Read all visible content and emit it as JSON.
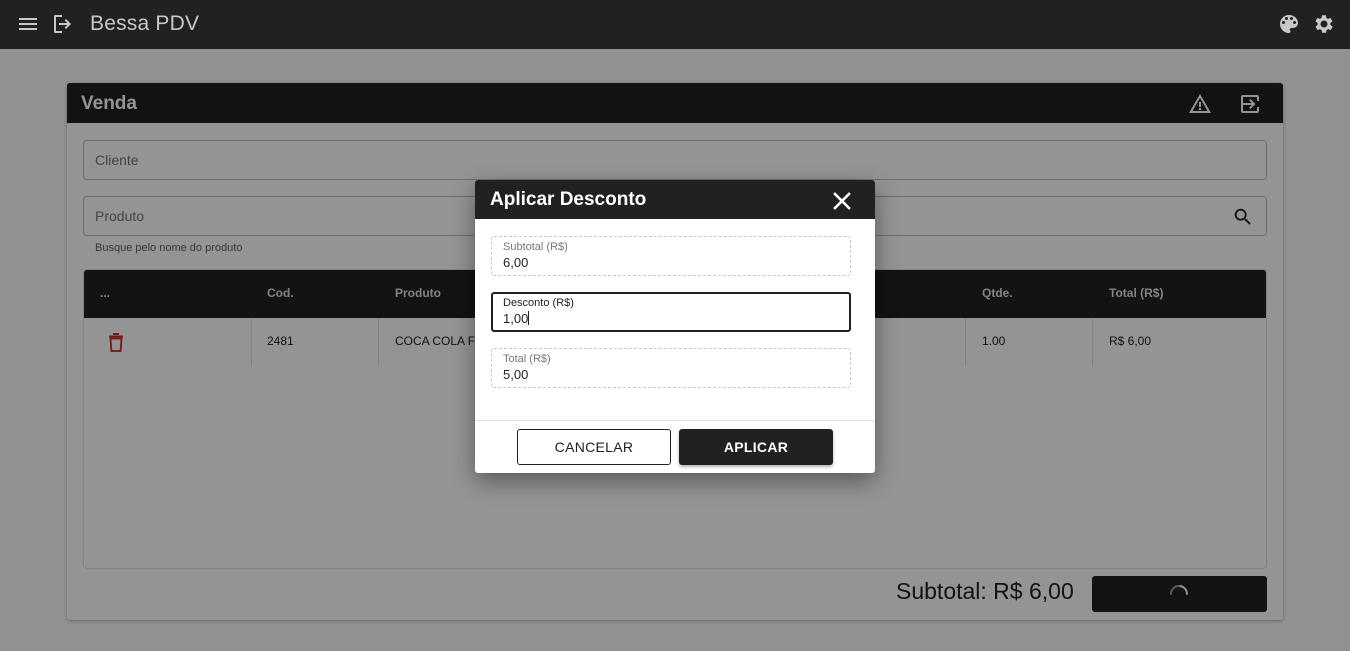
{
  "app": {
    "title": "Bessa PDV",
    "icons": {
      "menu": "menu-icon",
      "logout": "logout-icon",
      "palette": "palette-icon",
      "settings": "gear-icon"
    }
  },
  "venda": {
    "title": "Venda",
    "icons": {
      "warning": "warning-icon",
      "exit": "exit-to-app-icon"
    },
    "cliente_placeholder": "Cliente",
    "produto_placeholder": "Produto",
    "produto_hint": "Busque pelo nome do produto",
    "table": {
      "headers": [
        "...",
        "Cod.",
        "Produto",
        "Qtde.",
        "Total (R$)"
      ],
      "rows": [
        {
          "cod": "2481",
          "produto": "COCA COLA F",
          "qtde": "1.00",
          "total": "R$ 6,00"
        }
      ]
    },
    "subtotal_text": "Subtotal: R$ 6,00"
  },
  "dialog": {
    "title": "Aplicar Desconto",
    "subtotal_label": "Subtotal (R$)",
    "subtotal_value": "6,00",
    "desconto_label": "Desconto (R$)",
    "desconto_value": "1,00",
    "total_label": "Total (R$)",
    "total_value": "5,00",
    "cancel_label": "CANCELAR",
    "apply_label": "APLICAR"
  },
  "colors": {
    "dark": "#212121",
    "danger": "#c62828",
    "overlay": "rgba(0,0,0,0.42)"
  }
}
